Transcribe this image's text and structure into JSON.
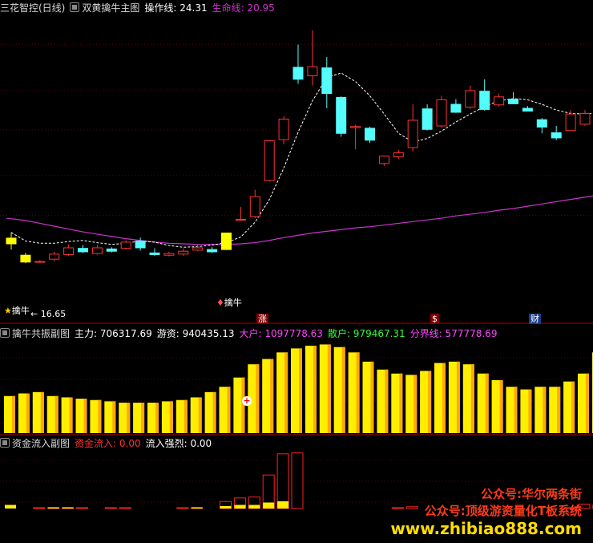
{
  "main_panel": {
    "title": "三花智控(日线)",
    "indicator": "双黄擒牛主图",
    "ops_label": "操作线: 24.31",
    "life_label": "生命线: 20.95",
    "low_label": "← 16.65",
    "signal_labels": [
      "擒牛",
      "擒牛"
    ],
    "markers": [
      "涨",
      "$",
      "财"
    ],
    "colors": {
      "up": "#ff3232",
      "down": "#54fcfc",
      "signal": "#ffff00",
      "life": "#cc33cc",
      "ops": "#ffffff"
    }
  },
  "resonance_panel": {
    "title": "擒牛共振副图",
    "main_force": "主力: 706317.69",
    "hot_money": "游资: 940435.13",
    "big": "大户: 1097778.63",
    "retail": "散户: 979467.31",
    "boundary": "分界线: 577778.69"
  },
  "flow_panel": {
    "title": "资金流入副图",
    "inflow": "资金流入: 0.00",
    "strength": "流入强烈: 0.00"
  },
  "watermarks": [
    "公众号:华尔两条街",
    "公众号:顶级游资量化T板系统",
    "www.zhibiao888.com"
  ],
  "chart_data": {
    "type": "candlestick",
    "candles": [
      [
        20,
        21,
        19,
        22,
        "y"
      ],
      [
        18,
        16.8,
        16.6,
        18.4,
        "y"
      ],
      [
        16.9,
        16.9,
        16.7,
        17.1,
        "u"
      ],
      [
        17.3,
        18.2,
        16.9,
        18.6,
        "u"
      ],
      [
        18.1,
        19.3,
        17.9,
        19.9,
        "u"
      ],
      [
        19.2,
        18.6,
        18.4,
        19.8,
        "d"
      ],
      [
        18.3,
        19.3,
        18.1,
        19.8,
        "u"
      ],
      [
        19.1,
        18.7,
        18.5,
        19.4,
        "d"
      ],
      [
        19.2,
        20.3,
        19.0,
        20.6,
        "u"
      ],
      [
        20.5,
        19.3,
        18.8,
        21.1,
        "d"
      ],
      [
        18.4,
        18.1,
        17.9,
        19.2,
        "d"
      ],
      [
        18.0,
        18.3,
        17.8,
        18.6,
        "u"
      ],
      [
        18.2,
        18.7,
        17.9,
        19.2,
        "u"
      ],
      [
        19.3,
        18.9,
        18.7,
        19.9,
        "u"
      ],
      [
        18.6,
        19.0,
        18.4,
        19.4,
        "d"
      ],
      [
        19.0,
        21.9,
        18.9,
        21.9,
        "y"
      ],
      [
        24.2,
        24.3,
        24.1,
        26.5,
        "u"
      ],
      [
        24.8,
        28.3,
        24.5,
        29.5,
        "u"
      ],
      [
        31.1,
        38.1,
        30.9,
        38.1,
        "u"
      ],
      [
        38.3,
        41.9,
        37.5,
        42.4,
        "u"
      ],
      [
        51.0,
        48.9,
        48.1,
        55.0,
        "d"
      ],
      [
        49.5,
        51.1,
        47.8,
        57.5,
        "u"
      ],
      [
        50.9,
        46.4,
        43.8,
        52.8,
        "d"
      ],
      [
        45.7,
        39.4,
        38.8,
        45.9,
        "d"
      ],
      [
        40.4,
        40.6,
        36.6,
        40.9,
        "u"
      ],
      [
        40.3,
        38.2,
        37.7,
        40.6,
        "d"
      ],
      [
        34.1,
        35.4,
        33.7,
        35.5,
        "u"
      ],
      [
        35.3,
        36.0,
        34.9,
        36.5,
        "u"
      ],
      [
        36.9,
        41.7,
        36.2,
        44.5,
        "u"
      ],
      [
        43.7,
        40.1,
        39.9,
        44.5,
        "d"
      ],
      [
        40.7,
        45.3,
        40.4,
        46.0,
        "u"
      ],
      [
        44.5,
        43.1,
        43.0,
        45.4,
        "d"
      ],
      [
        44.0,
        46.9,
        43.7,
        47.8,
        "u"
      ],
      [
        46.8,
        43.6,
        43.4,
        48.9,
        "d"
      ],
      [
        45.8,
        44.4,
        44.1,
        46.4,
        "u"
      ],
      [
        44.6,
        45.4,
        44.5,
        46.6,
        "d"
      ],
      [
        43.3,
        43.8,
        43.4,
        44.2,
        "d"
      ],
      [
        41.8,
        40.5,
        39.4,
        42.1,
        "d"
      ],
      [
        39.5,
        38.6,
        38.2,
        40.7,
        "d"
      ],
      [
        39.9,
        42.8,
        39.9,
        43.5,
        "u"
      ],
      [
        42.9,
        41.0,
        40.7,
        43.5,
        "u"
      ],
      [
        41.8,
        48.0,
        41.6,
        48.2,
        "u"
      ]
    ],
    "ops_line": [
      22,
      20.5,
      20.1,
      20.1,
      20.4,
      20.6,
      20.2,
      19.9,
      20.1,
      20.5,
      20.3,
      19.7,
      19.4,
      19.5,
      19.8,
      20.2,
      21.2,
      23.8,
      27.8,
      33.3,
      39.6,
      45.1,
      49.2,
      50.0,
      48.5,
      46.0,
      42.8,
      39.4,
      37.9,
      38.5,
      39.8,
      41.4,
      42.8,
      44.1,
      45.1,
      45.5,
      45.3,
      44.5,
      43.5,
      42.9,
      42.8,
      43.0
    ],
    "life_line": [
      24.5,
      24.1,
      23.6,
      23.1,
      22.6,
      22.1,
      21.7,
      21.3,
      20.9,
      20.6,
      20.3,
      20.1,
      20.0,
      19.9,
      19.9,
      19.9,
      20.0,
      20.2,
      20.6,
      21.1,
      21.5,
      21.9,
      22.2,
      22.5,
      22.8,
      23.0,
      23.3,
      23.6,
      23.9,
      24.2,
      24.5,
      24.9,
      25.2,
      25.5,
      25.9,
      26.2,
      26.6,
      27.0,
      27.4,
      27.8,
      28.2,
      28.6
    ],
    "resonance_bars": [
      28,
      30,
      31,
      28,
      27,
      26,
      25,
      24,
      23,
      23,
      23,
      24,
      25,
      27,
      31,
      35,
      42,
      52,
      56,
      61,
      64,
      66,
      67,
      65,
      61,
      54,
      48,
      45,
      44,
      47,
      53,
      54,
      52,
      45,
      40,
      35,
      33,
      35,
      35,
      39,
      45,
      61
    ],
    "flow_red": [
      0,
      0,
      1,
      1,
      1,
      1,
      0,
      1,
      1,
      0,
      0,
      0,
      1,
      1,
      0,
      8,
      12,
      13,
      38,
      62,
      63,
      0,
      0,
      0,
      0,
      0,
      0,
      1,
      2,
      0,
      0,
      0,
      0,
      0,
      0,
      0,
      0,
      0,
      0,
      1,
      5,
      4
    ],
    "flow_yellow": [
      3,
      0,
      0,
      1,
      1,
      0,
      0,
      0,
      0,
      0,
      0,
      0,
      0,
      1,
      0,
      2,
      3,
      3,
      5,
      6,
      0,
      0,
      0,
      0,
      0,
      0,
      0,
      0,
      0,
      0,
      0,
      0,
      0,
      0,
      0,
      0,
      0,
      0,
      0,
      0,
      0,
      2
    ]
  }
}
